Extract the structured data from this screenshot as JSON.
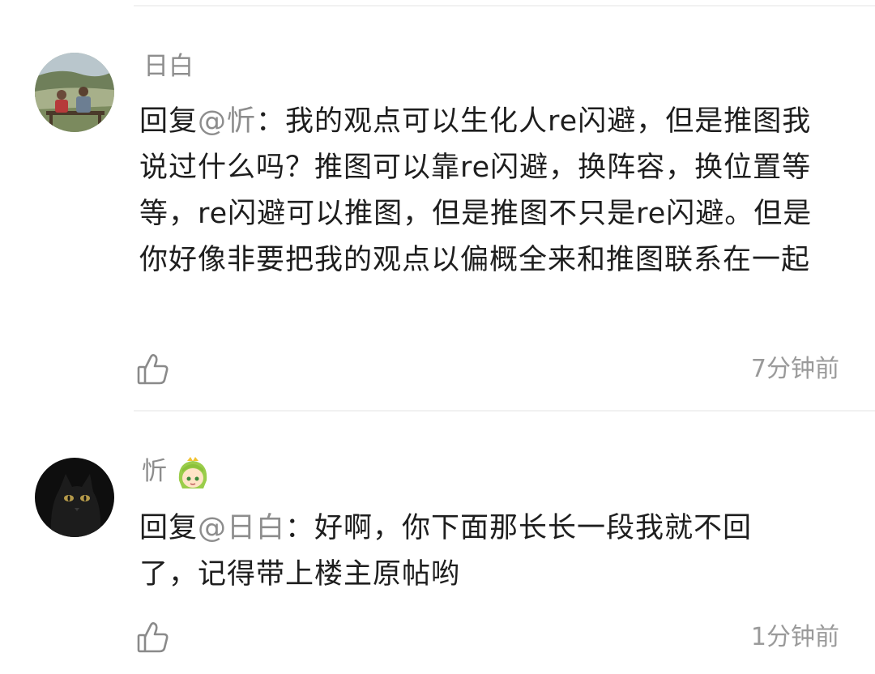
{
  "comments": [
    {
      "username": "日白",
      "reply_prefix": "回复",
      "mention": "@忻",
      "colon": "：",
      "text": "我的观点可以生化人re闪避，但是推图我说过什么吗？推图可以靠re闪避，换阵容，换位置等等，re闪避可以推图，但是推图不只是re闪避。但是你好像非要把我的观点以偏概全来和推图联系在一起",
      "time": "7分钟前",
      "avatar": "photo-avatar-two-people-landscape",
      "like_icon": "thumbs-up-icon"
    },
    {
      "username": "忻",
      "badge": "green-hair-girl-emoji",
      "reply_prefix": "回复",
      "mention": "@日白",
      "colon": "：",
      "text": "好啊，你下面那长长一段我就不回了，记得带上楼主原帖哟",
      "time": "1分钟前",
      "avatar": "black-cat-avatar",
      "like_icon": "thumbs-up-icon"
    }
  ],
  "colors": {
    "text": "#1e1e1e",
    "muted": "#8d8d8d",
    "divider": "#f1f1f1"
  }
}
